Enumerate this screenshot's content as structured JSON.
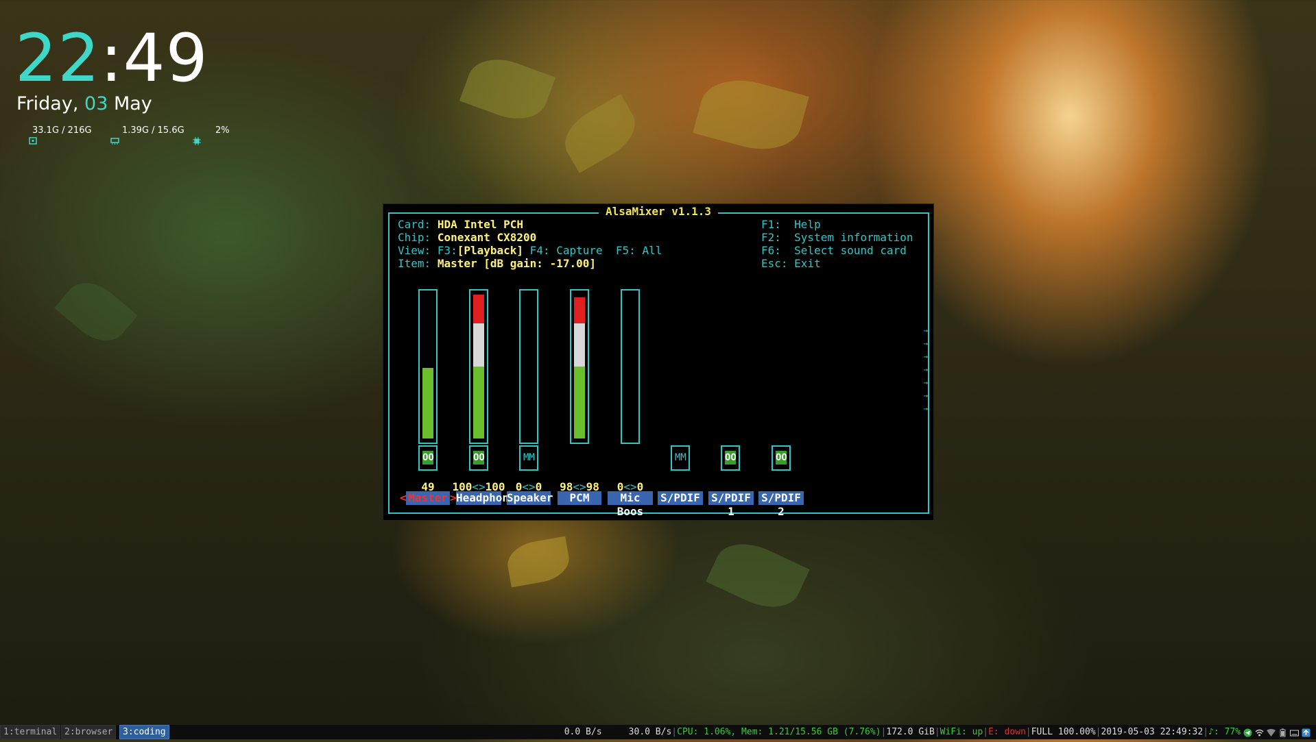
{
  "desktop": {
    "clock": {
      "hours": "22",
      "colon": ":",
      "minutes": "49"
    },
    "date": {
      "weekday": "Friday,",
      "day": "03",
      "month": "May"
    },
    "stats": {
      "disk": "33.1G / 216G",
      "memory": "1.39G / 15.6G",
      "cpu": "2%"
    }
  },
  "alsamixer": {
    "title": "AlsaMixer v1.1.3",
    "card_label": "Card:",
    "card_value": "HDA Intel PCH",
    "chip_label": "Chip:",
    "chip_value": "Conexant CX8200",
    "view_label": "View:",
    "view_f3": "F3:",
    "view_playback": "[Playback]",
    "view_rest": " F4: Capture  F5: All",
    "item_label": "Item:",
    "item_value": "Master [dB gain: -17.00]",
    "keys": [
      "F1:  Help",
      "F2:  System information",
      "F6:  Select sound card",
      "Esc: Exit"
    ],
    "channels": [
      {
        "name": "Master",
        "level": 49,
        "switch": "OO",
        "value_left": "49",
        "value_sep": "",
        "value_right": "",
        "selected": true
      },
      {
        "name": "Headphon",
        "level": 100,
        "switch": "OO",
        "value_left": "100",
        "value_sep": "<>",
        "value_right": "100",
        "selected": false
      },
      {
        "name": "Speaker",
        "level": 0,
        "switch": "MM",
        "value_left": "0",
        "value_sep": "<>",
        "value_right": "0",
        "selected": false
      },
      {
        "name": "PCM",
        "level": 98,
        "switch": "",
        "value_left": "98",
        "value_sep": "<>",
        "value_right": "98",
        "selected": false
      },
      {
        "name": "Mic Boos",
        "level": 0,
        "switch": "",
        "value_left": "0",
        "value_sep": "<>",
        "value_right": "0",
        "selected": false
      },
      {
        "name": "S/PDIF",
        "switch": "MM"
      },
      {
        "name": "S/PDIF 1",
        "switch": "OO"
      },
      {
        "name": "S/PDIF 2",
        "switch": "OO"
      }
    ],
    "selection_left": "<",
    "selection_right": ">"
  },
  "statusbar": {
    "workspaces": [
      "1:terminal",
      "2:browser",
      "3:coding"
    ],
    "active_workspace": "3:coding",
    "net_down": "0.0 B/s",
    "net_up": "30.0 B/s",
    "cpu": "CPU: 1.06%,",
    "mem": "Mem: 1.21/15.56 GB (7.76%)",
    "disk": "172.0 GiB",
    "wifi": "WiFi: up",
    "ethernet": "E: down",
    "battery": "FULL 100.00%",
    "datetime": "2019-05-03 22:49:32",
    "volume": "♪: 77%"
  },
  "colors": {
    "accent": "#2ec6c6",
    "value": "#fff27a",
    "label_bg": "#3a66b0",
    "level_green": "#6cbf2c",
    "level_white": "#d8d8d8",
    "level_red": "#e02020"
  }
}
